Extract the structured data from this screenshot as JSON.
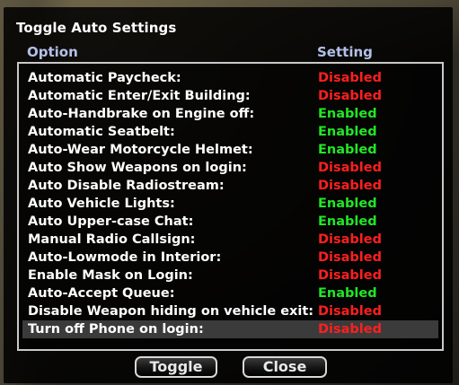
{
  "dialog": {
    "title": "Toggle Auto Settings",
    "columns": {
      "option": "Option",
      "setting": "Setting"
    },
    "rows": [
      {
        "option": "Automatic Paycheck:",
        "setting": "Disabled",
        "state": "disabled"
      },
      {
        "option": "Automatic Enter/Exit Building:",
        "setting": "Disabled",
        "state": "disabled"
      },
      {
        "option": "Auto-Handbrake on Engine off:",
        "setting": "Enabled",
        "state": "enabled"
      },
      {
        "option": "Automatic Seatbelt:",
        "setting": "Enabled",
        "state": "enabled"
      },
      {
        "option": "Auto-Wear Motorcycle Helmet:",
        "setting": "Enabled",
        "state": "enabled"
      },
      {
        "option": "Auto Show Weapons on login:",
        "setting": "Disabled",
        "state": "disabled"
      },
      {
        "option": "Auto Disable Radiostream:",
        "setting": "Disabled",
        "state": "disabled"
      },
      {
        "option": "Auto Vehicle Lights:",
        "setting": "Enabled",
        "state": "enabled"
      },
      {
        "option": "Auto Upper-case Chat:",
        "setting": "Enabled",
        "state": "enabled"
      },
      {
        "option": "Manual Radio Callsign:",
        "setting": "Disabled",
        "state": "disabled"
      },
      {
        "option": "Auto-Lowmode in Interior:",
        "setting": "Disabled",
        "state": "disabled"
      },
      {
        "option": "Enable Mask on Login:",
        "setting": "Disabled",
        "state": "disabled"
      },
      {
        "option": "Auto-Accept Queue:",
        "setting": "Enabled",
        "state": "enabled"
      },
      {
        "option": "Disable Weapon hiding on vehicle exit:",
        "setting": "Disabled",
        "state": "disabled"
      },
      {
        "option": "Turn off Phone on login:",
        "setting": "Disabled",
        "state": "disabled",
        "selected": true
      }
    ],
    "buttons": {
      "toggle": "Toggle",
      "close": "Close"
    }
  },
  "colors": {
    "enabled": "#22e626",
    "disabled": "#ff1f1f",
    "header": "#b3c0e8",
    "selected_row": "#3b3b3b"
  }
}
